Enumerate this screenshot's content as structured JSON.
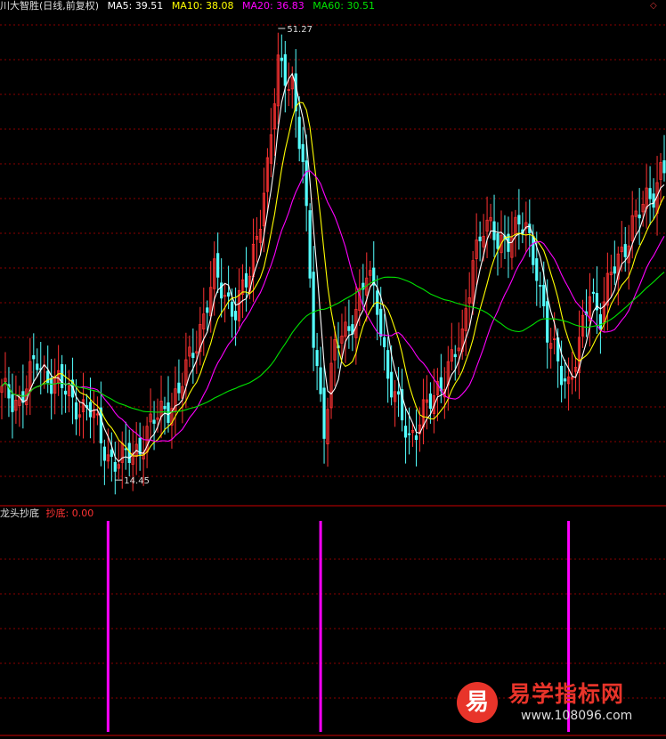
{
  "header": {
    "title": "川大智胜(日线,前复权)",
    "ma5_label": "MA5: 39.51",
    "ma10_label": "MA10: 38.08",
    "ma20_label": "MA20: 36.83",
    "ma60_label": "MA60: 30.51",
    "corner_icon": "diamond-icon"
  },
  "indicator": {
    "name": "龙头抄底",
    "series_label": "抄底: 0.00"
  },
  "watermark": {
    "logo_char": "易",
    "title": "易学指标网",
    "url": "www.108096.com"
  },
  "colors": {
    "background": "#000000",
    "up_candle": "#ff3232",
    "down_candle": "#54ffff",
    "ma5": "#ffffff",
    "ma10": "#ffff00",
    "ma20": "#ff00ff",
    "ma60": "#00e400",
    "signal": "#ff00ff",
    "grid": "#8b0000"
  },
  "chart_data": [
    {
      "type": "candlestick",
      "title": "川大智胜(日线,前复权)",
      "y_range": [
        12.5,
        52.5
      ],
      "annotations": [
        {
          "label": "51.27",
          "value": 51.27,
          "bar_index": 78
        },
        {
          "label": "14.45",
          "value": 14.45,
          "bar_index": 32
        }
      ],
      "moving_averages": [
        {
          "name": "MA5",
          "last": 39.51
        },
        {
          "name": "MA10",
          "last": 38.08
        },
        {
          "name": "MA20",
          "last": 36.83
        },
        {
          "name": "MA60",
          "last": 30.51
        }
      ],
      "key_closes": [
        [
          0,
          21.5
        ],
        [
          5,
          21.0
        ],
        [
          10,
          24.0
        ],
        [
          15,
          22.5
        ],
        [
          20,
          21.0
        ],
        [
          25,
          20.0
        ],
        [
          30,
          16.5
        ],
        [
          33,
          15.8
        ],
        [
          38,
          17.0
        ],
        [
          45,
          20.0
        ],
        [
          50,
          21.5
        ],
        [
          55,
          26.0
        ],
        [
          60,
          31.0
        ],
        [
          63,
          29.5
        ],
        [
          66,
          28.5
        ],
        [
          70,
          31.0
        ],
        [
          75,
          40.0
        ],
        [
          78,
          48.0
        ],
        [
          82,
          47.0
        ],
        [
          85,
          40.0
        ],
        [
          88,
          26.0
        ],
        [
          91,
          19.0
        ],
        [
          94,
          25.0
        ],
        [
          97,
          26.5
        ],
        [
          100,
          28.5
        ],
        [
          103,
          31.0
        ],
        [
          106,
          29.0
        ],
        [
          109,
          23.0
        ],
        [
          112,
          20.0
        ],
        [
          115,
          18.0
        ],
        [
          118,
          19.5
        ],
        [
          122,
          21.0
        ],
        [
          126,
          24.0
        ],
        [
          130,
          25.5
        ],
        [
          133,
          33.0
        ],
        [
          136,
          35.0
        ],
        [
          140,
          34.0
        ],
        [
          144,
          34.5
        ],
        [
          148,
          35.0
        ],
        [
          151,
          32.0
        ],
        [
          154,
          26.0
        ],
        [
          157,
          24.0
        ],
        [
          160,
          22.5
        ],
        [
          163,
          25.0
        ],
        [
          166,
          30.0
        ],
        [
          169,
          28.0
        ],
        [
          172,
          31.0
        ],
        [
          175,
          33.0
        ],
        [
          178,
          35.5
        ],
        [
          181,
          36.5
        ],
        [
          184,
          38.0
        ],
        [
          186,
          40.0
        ]
      ]
    },
    {
      "type": "bar",
      "title": "龙头抄底",
      "series": [
        {
          "name": "抄底",
          "last": 0.0
        }
      ],
      "signals": [
        {
          "bar_index": 30,
          "value": 1
        },
        {
          "bar_index": 90,
          "value": 1
        },
        {
          "bar_index": 160,
          "value": 1
        }
      ]
    }
  ]
}
